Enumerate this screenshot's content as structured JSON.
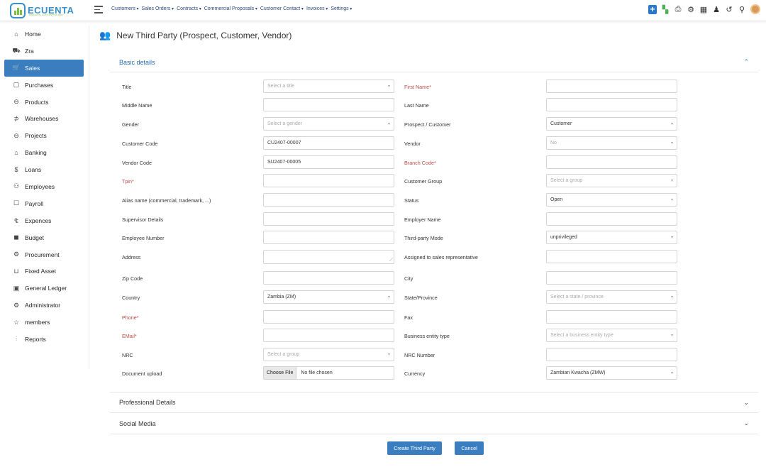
{
  "brand": {
    "name": "ECUENTA",
    "tagline": "FINANCIAL ACCOUNTING ERP"
  },
  "topnav": {
    "menus": [
      "Customers",
      "Sales Orders",
      "Contracts",
      "Commercial Proposals",
      "Customer Contact",
      "Invoices",
      "Settings"
    ],
    "icons": [
      "add-icon",
      "users-icon",
      "printer-icon",
      "gear-icon",
      "calendar-icon",
      "bell-icon",
      "history-icon",
      "location-icon"
    ]
  },
  "sidebar": {
    "items": [
      {
        "label": "Home",
        "icon": "home-icon",
        "glyph": "⌂"
      },
      {
        "label": "Zra",
        "icon": "car-icon",
        "glyph": "⛟"
      },
      {
        "label": "Sales",
        "icon": "cart-icon",
        "glyph": "🛒",
        "active": true
      },
      {
        "label": "Purchases",
        "icon": "bag-icon",
        "glyph": "▢"
      },
      {
        "label": "Products",
        "icon": "box-icon",
        "glyph": "⊖"
      },
      {
        "label": "Warehouses",
        "icon": "dolly-icon",
        "glyph": "⊅"
      },
      {
        "label": "Projects",
        "icon": "briefcase-icon",
        "glyph": "⊖"
      },
      {
        "label": "Banking",
        "icon": "bank-icon",
        "glyph": "⌂"
      },
      {
        "label": "Loans",
        "icon": "dollar-icon",
        "glyph": "$"
      },
      {
        "label": "Employees",
        "icon": "people-icon",
        "glyph": "⚇"
      },
      {
        "label": "Payroll",
        "icon": "payroll-icon",
        "glyph": "☐"
      },
      {
        "label": "Expences",
        "icon": "expense-icon",
        "glyph": "₠"
      },
      {
        "label": "Budget",
        "icon": "wallet-icon",
        "glyph": "◼"
      },
      {
        "label": "Procurement",
        "icon": "procurement-icon",
        "glyph": "⚙"
      },
      {
        "label": "Fixed Asset",
        "icon": "asset-icon",
        "glyph": "⊔"
      },
      {
        "label": "General Ledger",
        "icon": "ledger-icon",
        "glyph": "▣"
      },
      {
        "label": "Administrator",
        "icon": "admin-icon",
        "glyph": "⚙"
      },
      {
        "label": "members",
        "icon": "members-icon",
        "glyph": "☆"
      },
      {
        "label": "Reports",
        "icon": "chart-icon",
        "glyph": "⫶"
      }
    ]
  },
  "page": {
    "title": "New Third Party (Prospect, Customer, Vendor)"
  },
  "sections": {
    "basic": "Basic details",
    "professional": "Professional Details",
    "social": "Social Media"
  },
  "form": {
    "rows": [
      {
        "l": {
          "label": "Title",
          "type": "select",
          "ph": "Select a title"
        },
        "r": {
          "label": "First Name*",
          "req": true,
          "type": "text",
          "value": ""
        }
      },
      {
        "l": {
          "label": "Middle Name",
          "type": "text",
          "value": ""
        },
        "r": {
          "label": "Last Name",
          "type": "text",
          "value": ""
        }
      },
      {
        "l": {
          "label": "Gender",
          "type": "select",
          "ph": "Select a gender"
        },
        "r": {
          "label": "Prospect / Customer",
          "type": "select",
          "value": "Customer"
        }
      },
      {
        "l": {
          "label": "Customer Code",
          "type": "text",
          "value": "CU2407-00007"
        },
        "r": {
          "label": "Vendor",
          "type": "select",
          "ph": "No"
        }
      },
      {
        "l": {
          "label": "Vendor Code",
          "type": "text",
          "value": "SU2407-00005"
        },
        "r": {
          "label": "Branch Code*",
          "req": true,
          "type": "text",
          "value": ""
        }
      },
      {
        "l": {
          "label": "Tpin*",
          "req": true,
          "type": "text",
          "value": ""
        },
        "r": {
          "label": "Customer Group",
          "type": "select",
          "ph": "Select a group"
        }
      },
      {
        "l": {
          "label": "Alias name (commercial, trademark, ...)",
          "type": "text",
          "value": ""
        },
        "r": {
          "label": "Status",
          "type": "select",
          "value": "Open"
        }
      },
      {
        "l": {
          "label": "Supervisor Details",
          "type": "text",
          "value": ""
        },
        "r": {
          "label": "Employer Name",
          "type": "text",
          "value": ""
        }
      },
      {
        "l": {
          "label": "Employee Number",
          "type": "text",
          "value": ""
        },
        "r": {
          "label": "Third-party Mode",
          "type": "select",
          "value": "unprivileged"
        }
      },
      {
        "l": {
          "label": "Address",
          "type": "area",
          "value": ""
        },
        "r": {
          "label": "Assigned to sales representative",
          "type": "text",
          "value": ""
        }
      },
      {
        "l": {
          "label": "Zip Code",
          "type": "text",
          "value": ""
        },
        "r": {
          "label": "City",
          "type": "text",
          "value": ""
        }
      },
      {
        "l": {
          "label": "Country",
          "type": "select",
          "value": "Zambia (ZM)"
        },
        "r": {
          "label": "State/Province",
          "type": "select",
          "ph": "Select a state / province"
        }
      },
      {
        "l": {
          "label": "Phone*",
          "req": true,
          "type": "text",
          "value": ""
        },
        "r": {
          "label": "Fax",
          "type": "text",
          "value": ""
        }
      },
      {
        "l": {
          "label": "EMail*",
          "req": true,
          "type": "text",
          "value": ""
        },
        "r": {
          "label": "Business entity type",
          "type": "select",
          "ph": "Select a business entity type"
        }
      },
      {
        "l": {
          "label": "NRC",
          "type": "select",
          "ph": "Select a group"
        },
        "r": {
          "label": "NRC Number",
          "type": "text",
          "value": ""
        }
      },
      {
        "l": {
          "label": "Document upload",
          "type": "file",
          "btn": "Choose File",
          "value": "No file chosen"
        },
        "r": {
          "label": "Currency",
          "type": "select",
          "value": "Zambian Kwacha (ZMW)"
        }
      }
    ]
  },
  "actions": {
    "create": "Create Third Party",
    "cancel": "Cancel"
  }
}
